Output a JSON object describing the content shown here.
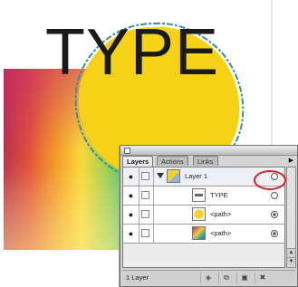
{
  "artwork": {
    "headline": "TYPE",
    "colors": {
      "yellow_circle": "#f7d117",
      "circle_outline": "#3f8f8a",
      "headline": "#1a1a1a"
    }
  },
  "layers_panel": {
    "tabs": [
      {
        "label": "Layers",
        "active": true
      },
      {
        "label": "Actions",
        "active": false
      },
      {
        "label": "Links",
        "active": false
      }
    ],
    "menu_icon": "panel-menu-arrow-icon",
    "rows": [
      {
        "name": "Layer 1",
        "kind": "layer",
        "expanded": true,
        "visible": true,
        "target_highlighted": true
      },
      {
        "name": "TYPE",
        "kind": "type",
        "visible": false
      },
      {
        "name": "<path>",
        "kind": "path",
        "visible": true
      },
      {
        "name": "<path>",
        "kind": "path",
        "visible": true
      }
    ],
    "footer": {
      "layer_count": "1 Layer",
      "buttons": [
        "make-clipping-mask-icon",
        "create-sublayer-icon",
        "new-layer-icon",
        "delete-icon"
      ]
    },
    "highlight_color": "#d2232a"
  }
}
